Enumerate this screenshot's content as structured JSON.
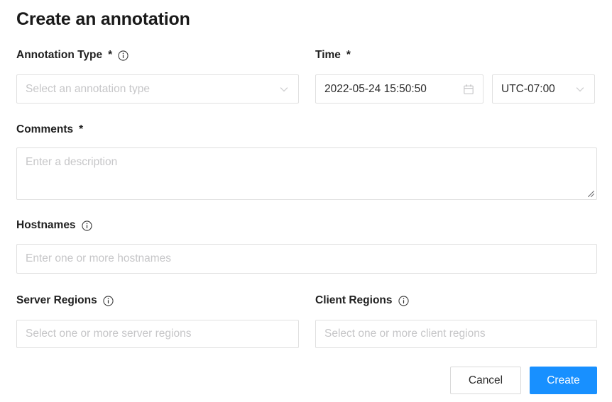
{
  "dialog": {
    "title": "Create an annotation"
  },
  "fields": {
    "annotation_type": {
      "label": "Annotation Type",
      "required_marker": "*",
      "has_info": true,
      "placeholder": "Select an annotation type",
      "value": "",
      "icon": "chevron-down-icon"
    },
    "time": {
      "label": "Time",
      "required_marker": "*",
      "has_info": false,
      "value": "2022-05-24 15:50:50",
      "placeholder": "",
      "icon": "calendar-icon"
    },
    "timezone": {
      "label": "",
      "value": "UTC-07:00",
      "icon": "chevron-down-icon"
    },
    "comments": {
      "label": "Comments",
      "required_marker": "*",
      "has_info": false,
      "placeholder": "Enter a description",
      "value": ""
    },
    "hostnames": {
      "label": "Hostnames",
      "required_marker": "",
      "has_info": true,
      "placeholder": "Enter one or more hostnames",
      "value": ""
    },
    "server_regions": {
      "label": "Server Regions",
      "required_marker": "",
      "has_info": true,
      "placeholder": "Select one or more server regions",
      "value": ""
    },
    "client_regions": {
      "label": "Client Regions",
      "required_marker": "",
      "has_info": true,
      "placeholder": "Select one or more client regions",
      "value": ""
    }
  },
  "footer": {
    "cancel_label": "Cancel",
    "create_label": "Create"
  },
  "colors": {
    "primary": "#1890ff",
    "border": "#e0e0e0",
    "button_border": "#d9d9d9",
    "placeholder": "#c6c6c8",
    "text": "#1f1f1f"
  }
}
